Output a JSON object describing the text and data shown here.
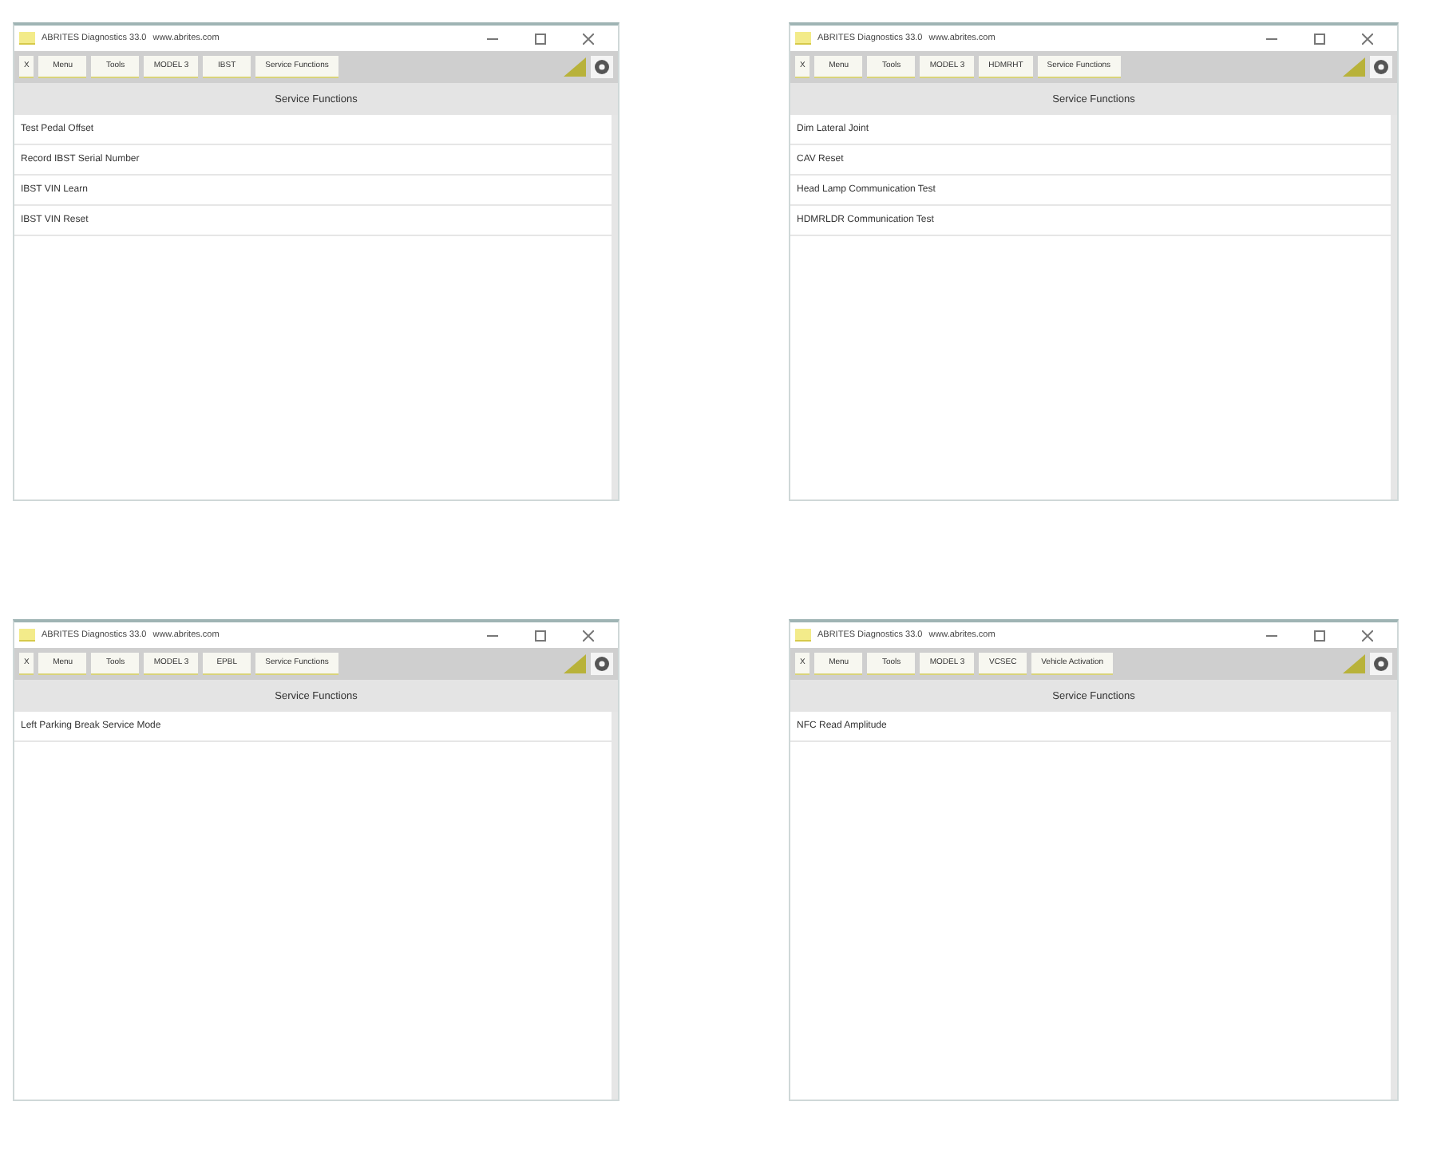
{
  "windows": [
    {
      "title": "ABRITES Diagnostics 33.0",
      "url": "www.abrites.com",
      "toolbar": [
        "X",
        "Menu",
        "Tools",
        "MODEL 3",
        "IBST",
        "Service Functions"
      ],
      "header": "Service Functions",
      "items": [
        "Test Pedal Offset",
        "Record IBST Serial Number",
        "IBST VIN Learn",
        "IBST VIN Reset"
      ]
    },
    {
      "title": "ABRITES Diagnostics 33.0",
      "url": "www.abrites.com",
      "toolbar": [
        "X",
        "Menu",
        "Tools",
        "MODEL 3",
        "HDMRHT",
        "Service Functions"
      ],
      "header": "Service Functions",
      "items": [
        "Dim Lateral Joint",
        "CAV Reset",
        "Head Lamp Communication Test",
        "HDMRLDR Communication Test"
      ]
    },
    {
      "title": "ABRITES Diagnostics 33.0",
      "url": "www.abrites.com",
      "toolbar": [
        "X",
        "Menu",
        "Tools",
        "MODEL 3",
        "EPBL",
        "Service Functions"
      ],
      "header": "Service Functions",
      "items": [
        "Left Parking Break Service Mode"
      ]
    },
    {
      "title": "ABRITES Diagnostics 33.0",
      "url": "www.abrites.com",
      "toolbar": [
        "X",
        "Menu",
        "Tools",
        "MODEL 3",
        "VCSEC",
        "Vehicle Activation"
      ],
      "header": "Service Functions",
      "items": [
        "NFC Read Amplitude"
      ]
    }
  ]
}
